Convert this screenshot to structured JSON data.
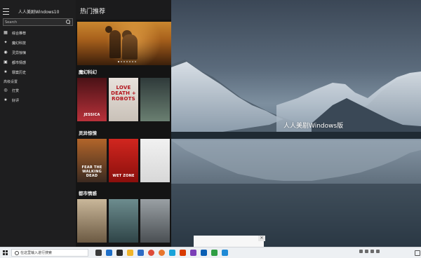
{
  "app": {
    "title": "人人美剧Windows10"
  },
  "search": {
    "placeholder": "Search"
  },
  "nav": {
    "items": [
      {
        "icon": "grid-icon",
        "glyph": "▦",
        "label": "综合推荐"
      },
      {
        "icon": "magic-icon",
        "glyph": "✦",
        "label": "魔幻科技"
      },
      {
        "icon": "ghost-icon",
        "glyph": "◉",
        "label": "灵异惊悚"
      },
      {
        "icon": "city-icon",
        "glyph": "▣",
        "label": "都市情感"
      },
      {
        "icon": "history-icon",
        "glyph": "★",
        "label": "罪案历史"
      }
    ],
    "section_label": "高级设置",
    "settings_items": [
      {
        "icon": "eye-icon",
        "glyph": "◎",
        "label": "打赏"
      },
      {
        "icon": "star-icon",
        "glyph": "★",
        "label": "好评"
      }
    ]
  },
  "content": {
    "title": "热门推荐",
    "hero_pages": 7,
    "hero_active": 0,
    "sections": [
      {
        "title": "魔幻科幻",
        "posters": [
          {
            "text": "JESSICA",
            "colors": [
              "#4a1216",
              "#b8313a"
            ]
          },
          {
            "text": "LOVE DEATH + ROBOTS",
            "colors": [
              "#e8e2dc",
              "#c9c1b8"
            ],
            "textColor": "#b3121b"
          },
          {
            "text": "",
            "colors": [
              "#2f3a3a",
              "#6a7f71"
            ]
          }
        ]
      },
      {
        "title": "灵异惊悚",
        "posters": [
          {
            "text": "FEAR THE WALKING DEAD",
            "colors": [
              "#b2652a",
              "#3b2a20"
            ]
          },
          {
            "text": "WET ZONE",
            "colors": [
              "#d1261f",
              "#8a0f0c"
            ]
          },
          {
            "text": "",
            "colors": [
              "#f1f1f1",
              "#d8d8d8"
            ]
          }
        ]
      },
      {
        "title": "都市情感",
        "posters": [
          {
            "text": "",
            "colors": [
              "#c9b79a",
              "#6c5a43"
            ]
          },
          {
            "text": "",
            "colors": [
              "#6d8c8e",
              "#2f4447"
            ]
          },
          {
            "text": "",
            "colors": [
              "#9aa0a4",
              "#4a4f53"
            ]
          }
        ]
      }
    ]
  },
  "wallpaper": {
    "title": "人人美剧Windows版"
  },
  "taskbar": {
    "search_placeholder": "在这里输入进行搜索",
    "tray_chip": "",
    "apps": [
      {
        "icon": "task-view-icon",
        "color": "#3a3a3a"
      },
      {
        "icon": "edge-icon",
        "color": "#1e6fc8"
      },
      {
        "icon": "store-icon",
        "color": "#2c2c2c"
      },
      {
        "icon": "file-explorer-icon",
        "color": "#f0b429"
      },
      {
        "icon": "mail-icon",
        "color": "#2d6bc4"
      },
      {
        "icon": "chrome-icon",
        "color": "#dd4b39"
      },
      {
        "icon": "firefox-icon",
        "color": "#e8762d"
      },
      {
        "icon": "app-icon",
        "color": "#1aa3d9"
      },
      {
        "icon": "office-icon",
        "color": "#d83b01"
      },
      {
        "icon": "visual-studio-icon",
        "color": "#7b3fb7"
      },
      {
        "icon": "blue-app-icon",
        "color": "#0a5fb4"
      },
      {
        "icon": "green-app-icon",
        "color": "#2f9e44"
      },
      {
        "icon": "photos-icon",
        "color": "#1f8ad6"
      }
    ]
  }
}
